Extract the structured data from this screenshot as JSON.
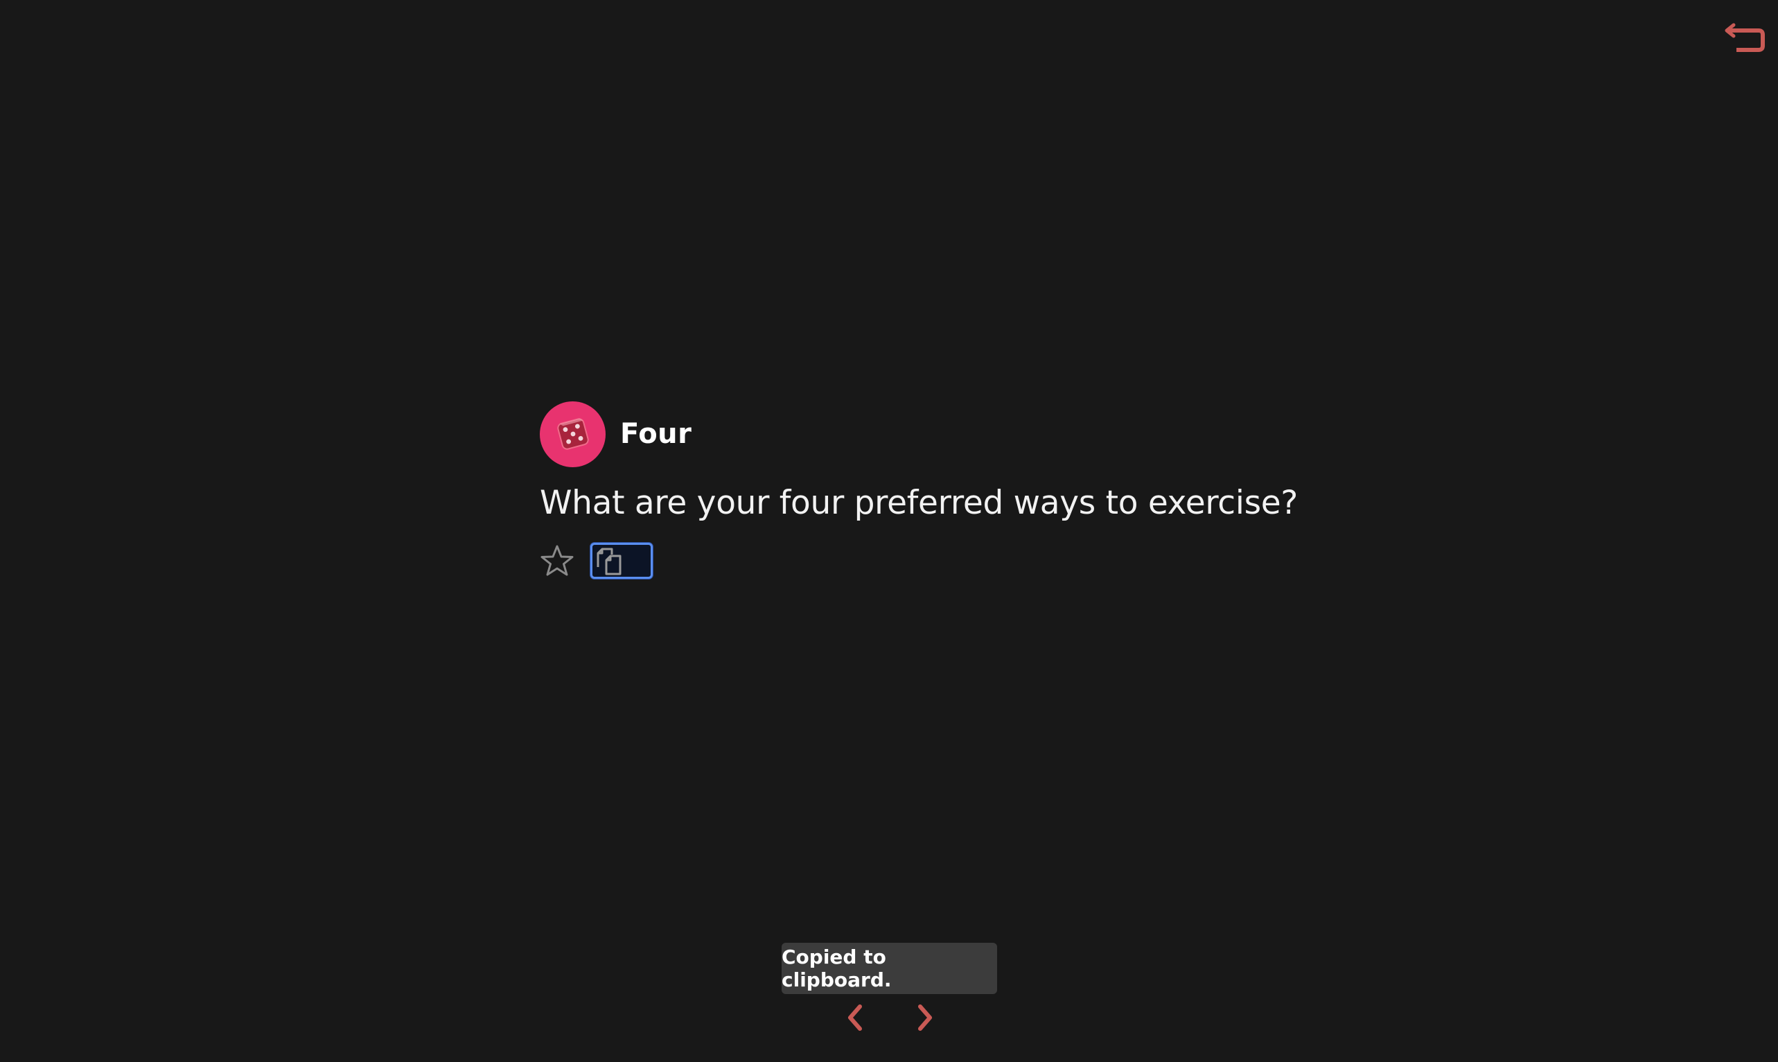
{
  "colors": {
    "background": "#181818",
    "accent": "#c95a55",
    "avatar": "#e8336f",
    "focus": "#5a8ef0",
    "toast": "#3c3c3c"
  },
  "header": {
    "back_icon": "return-arrow-icon"
  },
  "card": {
    "avatar_icon": "dice-icon",
    "category": "Four",
    "question": "What are your four preferred ways to exercise?",
    "favorite_icon": "star-outline-icon",
    "copy_icon": "copy-icon"
  },
  "toast": {
    "message": "Copied to clipboard."
  },
  "navigation": {
    "prev_icon": "chevron-left-icon",
    "next_icon": "chevron-right-icon"
  }
}
